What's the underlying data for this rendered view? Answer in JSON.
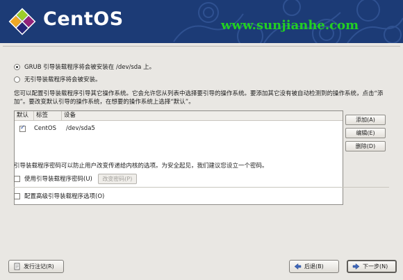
{
  "header": {
    "brand": "CentOS",
    "watermark": "www.sunjianhe.com"
  },
  "bootloader": {
    "install_option": "GRUB 引导装载程序将会被安装在 /dev/sda 上。",
    "no_install_option": "无引导装载程序将会被安装。",
    "description": "您可以配置引导装载程序引导其它操作系统。它会允许您从列表中选择要引导的操作系统。要添加其它没有被自动检测到的操作系统，点击“添加”。要改变默认引导的操作系统，在想要的操作系统上选择“默认”。",
    "table": {
      "columns": [
        "默认",
        "标签",
        "设备"
      ],
      "rows": [
        {
          "default": true,
          "label": "CentOS",
          "device": "/dev/sda5"
        }
      ]
    },
    "buttons": {
      "add": "添加(A)",
      "edit": "编辑(E)",
      "delete": "删除(D)"
    },
    "password_hint": "引导装载程序密码可以防止用户改变传递给内核的选项。为安全起见，我们建议您设立一个密码。",
    "use_password": "使用引导装载程序密码(U)",
    "change_password": "改变密码(P)",
    "advanced": "配置高级引导装载程序选项(O)"
  },
  "footer": {
    "release_notes": "发行注记(R)",
    "back": "后退(B)",
    "next": "下一步(N)"
  },
  "colors": {
    "banner": "#1c3b76",
    "watermark": "#22d022"
  }
}
